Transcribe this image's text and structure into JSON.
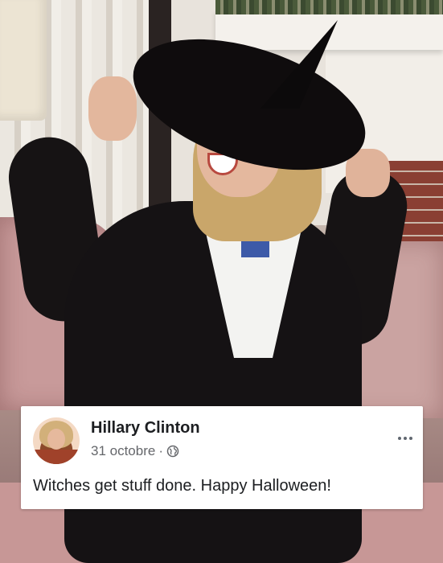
{
  "post": {
    "author_name": "Hillary Clinton",
    "date": "31 octobre",
    "separator": "·",
    "privacy_icon": "globe-icon",
    "more_icon": "more-options-icon",
    "text": "Witches get stuff done. Happy Halloween!"
  },
  "colors": {
    "card_background": "#ffffff",
    "name_text": "#1c1e21",
    "meta_text": "#65676b"
  }
}
